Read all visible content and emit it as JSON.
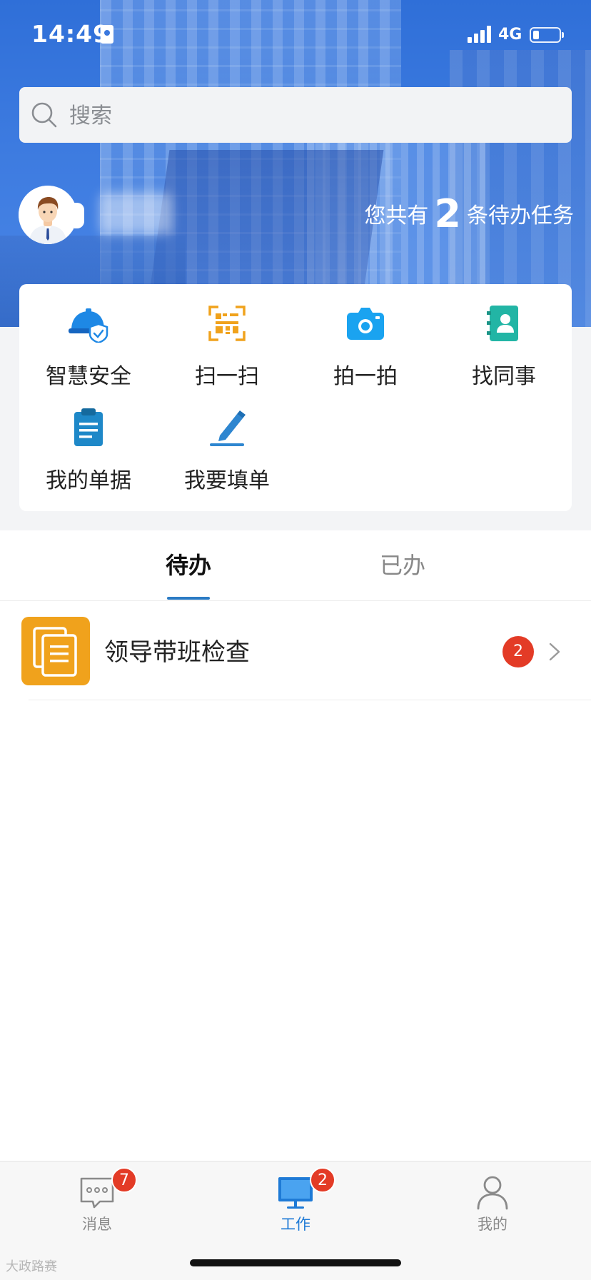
{
  "status_bar": {
    "time": "14:49",
    "network": "4G"
  },
  "search": {
    "placeholder": "搜索"
  },
  "user": {
    "todo_prefix": "您共有",
    "todo_count": "2",
    "todo_suffix": "条待办任务"
  },
  "quick_actions": [
    {
      "label": "智慧安全",
      "icon": "safety-helmet-icon",
      "color": "#1e88e5"
    },
    {
      "label": "扫一扫",
      "icon": "scan-qr-icon",
      "color": "#f0a21c"
    },
    {
      "label": "拍一拍",
      "icon": "camera-icon",
      "color": "#1aa3f0"
    },
    {
      "label": "找同事",
      "icon": "contacts-icon",
      "color": "#22b5a5"
    },
    {
      "label": "我的单据",
      "icon": "clipboard-icon",
      "color": "#1e88c8"
    },
    {
      "label": "我要填单",
      "icon": "pen-edit-icon",
      "color": "#2e86d0"
    }
  ],
  "tabs": [
    {
      "label": "待办",
      "active": true
    },
    {
      "label": "已办",
      "active": false
    }
  ],
  "tasks": [
    {
      "title": "领导带班检查",
      "badge": "2",
      "icon": "documents-icon"
    }
  ],
  "bottom_nav": [
    {
      "label": "消息",
      "badge": "7",
      "icon": "chat-bubble-icon",
      "active": false
    },
    {
      "label": "工作",
      "badge": "2",
      "icon": "monitor-icon",
      "active": true
    },
    {
      "label": "我的",
      "badge": "",
      "icon": "person-icon",
      "active": false
    }
  ],
  "watermark": "大政路赛",
  "colors": {
    "brand_blue": "#2f6fd8",
    "accent_blue": "#1e7ad6",
    "badge_red": "#e33b26",
    "task_icon_orange": "#f0a21c"
  }
}
